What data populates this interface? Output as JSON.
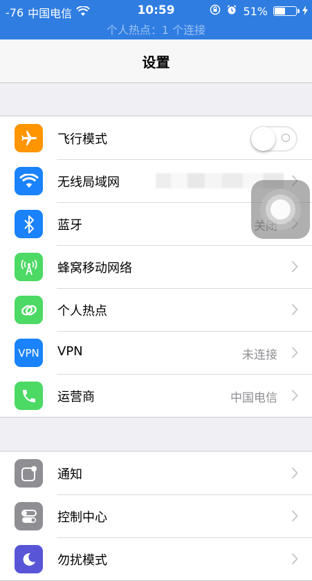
{
  "status_bar": {
    "signal": "-76",
    "carrier": "中国电信",
    "time": "10:59",
    "battery_percent": "51%",
    "battery_level": 0.51,
    "hotspot_banner": "个人热点：1 个连接"
  },
  "nav": {
    "title": "设置"
  },
  "group1": [
    {
      "label": "飞行模式",
      "icon": "airplane-icon",
      "color": "#ff9500",
      "toggle_on": false
    },
    {
      "label": "无线局域网",
      "icon": "wifi-icon",
      "color": "#1a82fb",
      "value": ""
    },
    {
      "label": "蓝牙",
      "icon": "bluetooth-icon",
      "color": "#1a82fb",
      "value": "关闭"
    },
    {
      "label": "蜂窝移动网络",
      "icon": "cellular-icon",
      "color": "#4cd964"
    },
    {
      "label": "个人热点",
      "icon": "hotspot-icon",
      "color": "#4cd964"
    },
    {
      "label": "VPN",
      "icon": "vpn-icon",
      "icon_text": "VPN",
      "color": "#1a82fb",
      "value": "未连接"
    },
    {
      "label": "运营商",
      "icon": "phone-icon",
      "color": "#4cd964",
      "value": "中国电信"
    }
  ],
  "group2": [
    {
      "label": "通知",
      "icon": "notifications-icon",
      "color": "#8e8e93"
    },
    {
      "label": "控制中心",
      "icon": "control-center-icon",
      "color": "#8e8e93"
    },
    {
      "label": "勿扰模式",
      "icon": "moon-icon",
      "color": "#5856d6"
    }
  ]
}
